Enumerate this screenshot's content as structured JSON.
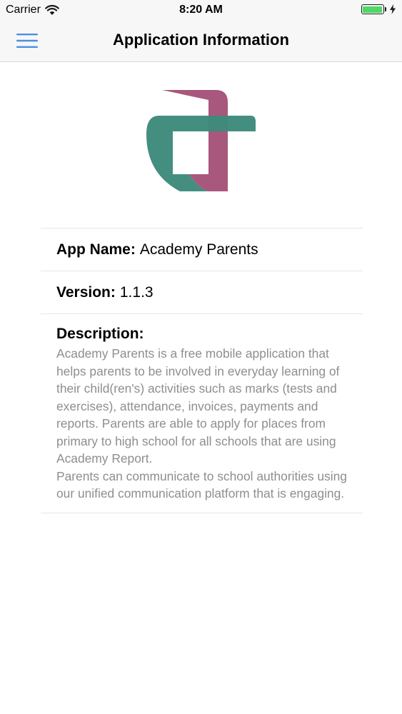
{
  "status_bar": {
    "carrier": "Carrier",
    "time": "8:20 AM",
    "battery_level": 1.0,
    "battery_color": "#4cd964",
    "icons": [
      "wifi-icon",
      "battery-icon",
      "charging-bolt-icon"
    ]
  },
  "nav": {
    "title": "Application Information",
    "menu_icon": "hamburger-menu-icon",
    "accent_color": "#4a90e2"
  },
  "logo": {
    "icon": "academy-logo",
    "colors": {
      "teal": "#3d8a7b",
      "magenta": "#a8587c"
    }
  },
  "info": {
    "app_name_label": "App Name:",
    "app_name_value": "Academy Parents",
    "version_label": "Version:",
    "version_value": "1.1.3",
    "description_label": "Description:",
    "description_paragraph_1": "Academy Parents is a free mobile application that helps parents to be involved in everyday learning of their child(ren's) activities such as marks (tests and exercises), attendance, invoices, payments and reports. Parents are able to apply for places from primary to high school for all schools that are using Academy Report.",
    "description_paragraph_2": "Parents can communicate to school authorities using our unified communication platform that is engaging."
  }
}
